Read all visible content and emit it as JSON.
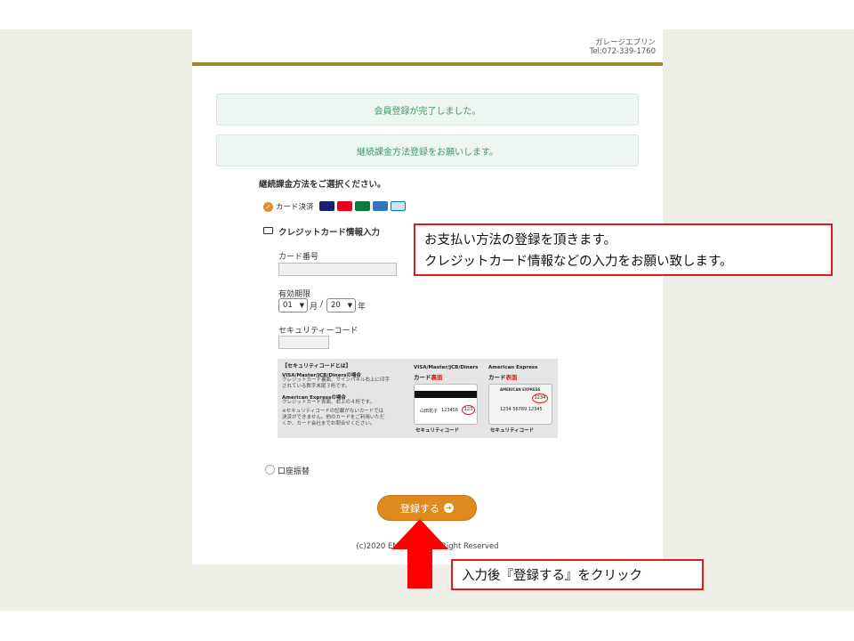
{
  "header": {
    "shop_name": "ガレージエプリン",
    "tel": "Tel:072-339-1760"
  },
  "messages": [
    "会員登録が完了しました。",
    "継続課金方法登録をお願いします。"
  ],
  "section_title": "継続課金方法をご選択ください。",
  "card_option": {
    "label": "カード決済",
    "brands": [
      {
        "name": "visa",
        "color": "#1a1f71"
      },
      {
        "name": "mastercard",
        "color": "#eb001b"
      },
      {
        "name": "jcb",
        "color": "#0b7a3e"
      },
      {
        "name": "amex",
        "color": "#2e77bc"
      },
      {
        "name": "diners",
        "color": "#0079be"
      }
    ]
  },
  "credit_card": {
    "title": "クレジットカード情報入力",
    "card_number_label": "カード番号",
    "card_number_value": "",
    "expiry_label": "有効期限",
    "month_value": "01",
    "month_unit": "月",
    "separator": "/",
    "year_value": "20",
    "year_unit": "年",
    "cvc_label": "セキュリティーコード",
    "cvc_value": ""
  },
  "security_info": {
    "heading": "【セキュリティコードとは】",
    "visa_head": "VISA/Master/JCB/Dinersの場合",
    "visa_text1": "クレジットカード裏面、サインパネル右上に印字",
    "visa_text2": "されている数字末尾３桁です。",
    "amex_head": "American Expressの場合",
    "amex_text": "クレジットカード表面、右上の４桁です。",
    "note1": "※セキュリティコードの記載がないカードでは",
    "note2": "決済ができません。他のカードをご利用いただ",
    "note3": "くか、カード会社までお問合せください。",
    "card1_title": "VISA/Master/JCB/Diners",
    "card1_sub_a": "カード",
    "card1_sub_b": "裏面",
    "card1_name": "山田花子",
    "card1_number": "123456",
    "card1_code": "123",
    "card2_title": "American Express",
    "card2_sub_a": "カード",
    "card2_sub_b": "表面",
    "card2_brand": "AMERICAN EXPRESS",
    "card2_code": "1234",
    "card2_number": "1234 56789 12345",
    "code_caption": "セキュリティコード"
  },
  "bank_option": {
    "label": "口座振替"
  },
  "submit": {
    "label": "登録する"
  },
  "copyright": "(c)2020 ENERGY  T. All Right Reserved",
  "annotations": {
    "callout1_line1": "お支払い方法の登録を頂きます。",
    "callout1_line2": "クレジットカード情報などの入力をお願い致します。",
    "callout2": "入力後『登録する』をクリック"
  }
}
